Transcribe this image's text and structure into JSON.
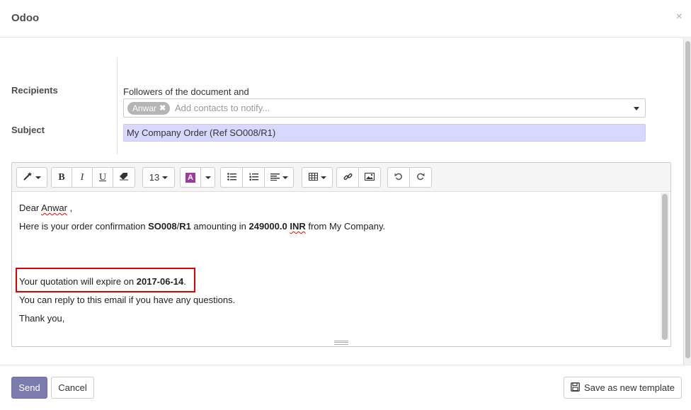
{
  "dialog": {
    "title": "Odoo",
    "close_symbol": "×"
  },
  "form": {
    "recipients_label": "Recipients",
    "followers_text": "Followers of the document and",
    "recipient_tag": "Anwar",
    "recipients_placeholder": "Add contacts to notify...",
    "subject_label": "Subject",
    "subject_value": "My Company Order (Ref SO008/R1)"
  },
  "toolbar": {
    "font_size": "13"
  },
  "body": {
    "greeting_1": "Dear ",
    "greeting_name": "Anwar",
    "greeting_2": " ,",
    "line1_a": "Here is your order confirmation ",
    "line1_order": "SO008",
    "line1_b": "/",
    "line1_rev": "R1",
    "line1_c": " amounting in ",
    "line1_amount": "249000.0 ",
    "line1_currency": "INR",
    "line1_d": " from My Company.",
    "expire_text": "Your quotation will expire on ",
    "expire_date": "2017-06-14",
    "expire_end": ".",
    "reply_line": "You can reply to this email if you have any questions.",
    "thanks_line": "Thank you,"
  },
  "footer": {
    "send_label": "Send",
    "cancel_label": "Cancel",
    "template_label": "Save as new template"
  },
  "colors": {
    "send_button": "#7c7bad",
    "subject_bg": "#d8d8ff",
    "highlight_border": "#e00000",
    "font_color_swatch": "#9b3b9b"
  }
}
